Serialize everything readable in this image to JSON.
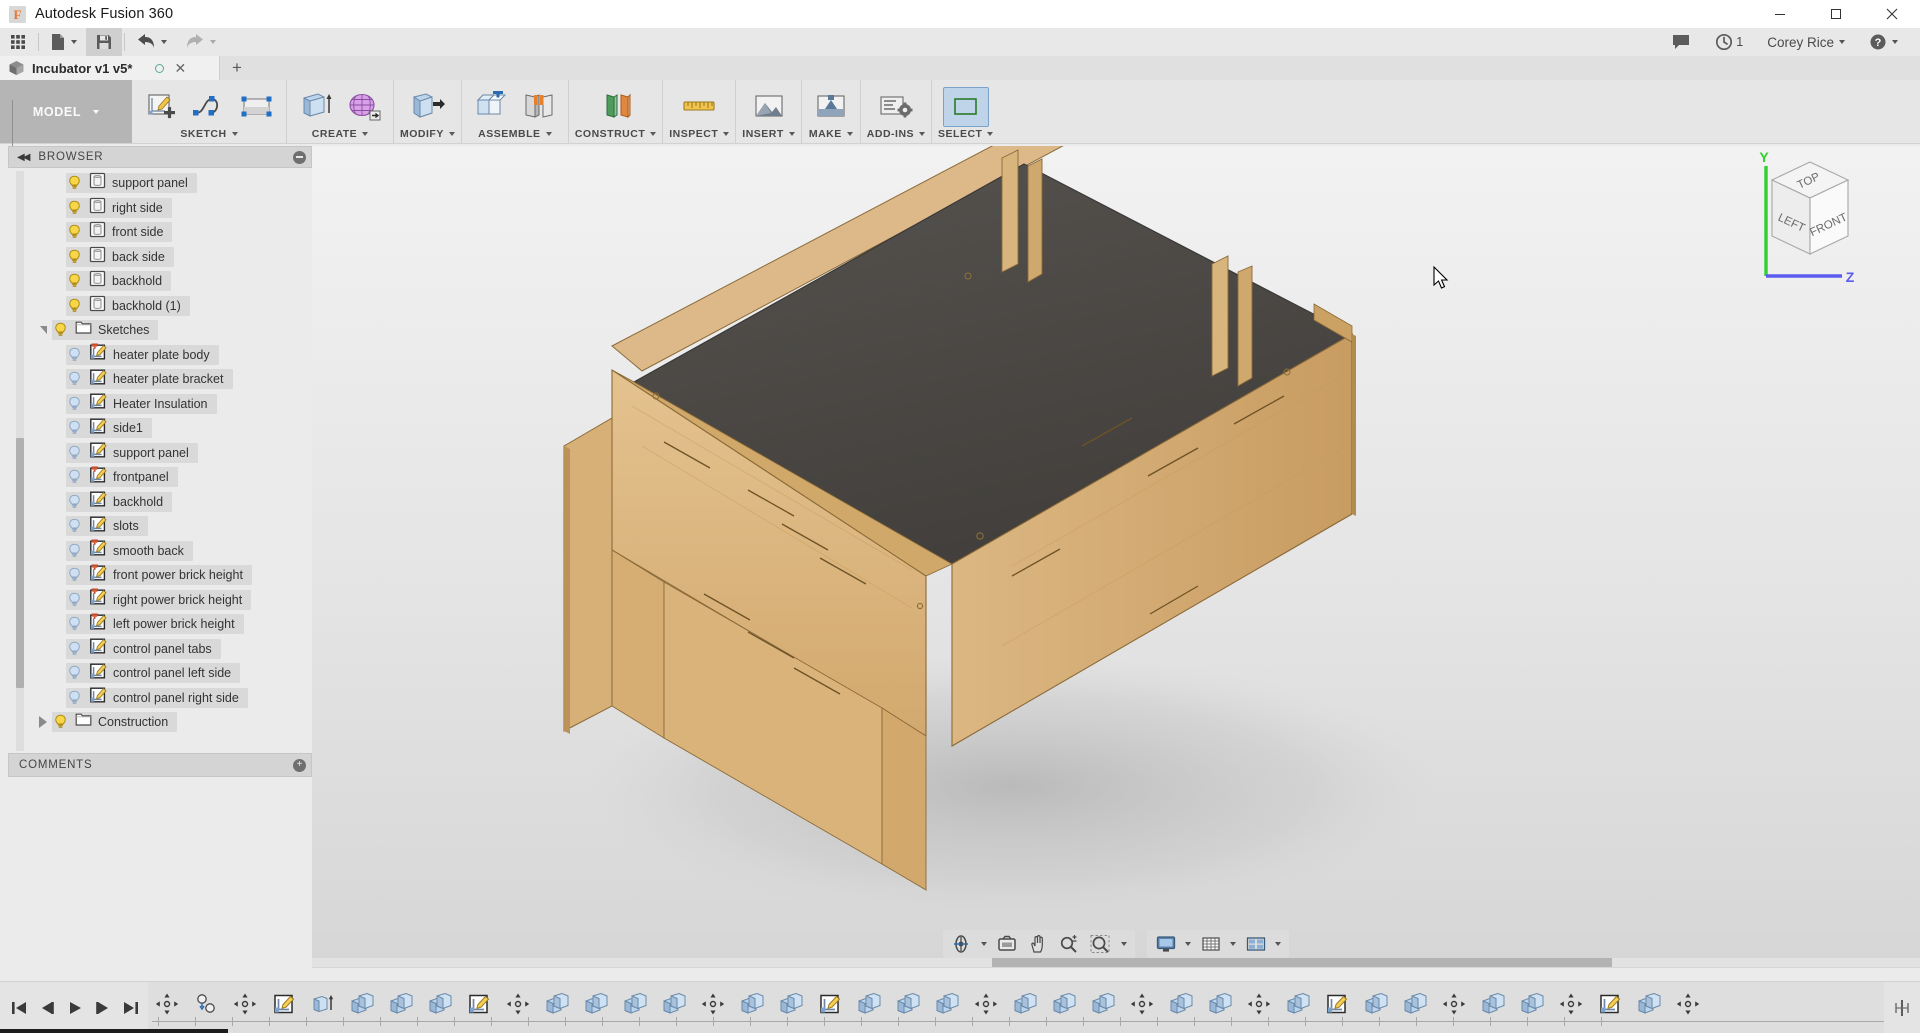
{
  "window": {
    "app_title": "Autodesk Fusion 360",
    "logo_letter": "F",
    "minimize": "minimize-icon",
    "maximize": "maximize-icon",
    "close": "close-icon"
  },
  "quick_access": {
    "grid_menu": "app-grid-icon",
    "new_file": "new-file-icon",
    "save": "save-icon",
    "undo": "undo-icon",
    "redo": "redo-icon",
    "comments_icon": "comment-icon",
    "job_status_icon": "clock-icon",
    "job_status_count": "1",
    "user_name": "Corey Rice",
    "help_icon": "help-icon"
  },
  "document_tabs": {
    "active_tab": "Incubator v1 v5*",
    "new_tab_label": "+"
  },
  "ribbon": {
    "workspace_label": "MODEL",
    "groups": [
      {
        "label": "SKETCH",
        "tools": [
          "create-sketch-icon",
          "spline-icon",
          "rectangle-icon"
        ]
      },
      {
        "label": "CREATE",
        "tools": [
          "extrude-icon",
          "form-icon"
        ]
      },
      {
        "label": "MODIFY",
        "tools": [
          "press-pull-icon"
        ]
      },
      {
        "label": "ASSEMBLE",
        "tools": [
          "new-component-icon",
          "joint-icon"
        ]
      },
      {
        "label": "CONSTRUCT",
        "tools": [
          "offset-plane-icon"
        ]
      },
      {
        "label": "INSPECT",
        "tools": [
          "measure-icon"
        ]
      },
      {
        "label": "INSERT",
        "tools": [
          "insert-mesh-icon"
        ]
      },
      {
        "label": "MAKE",
        "tools": [
          "3d-print-icon"
        ]
      },
      {
        "label": "ADD-INS",
        "tools": [
          "scripts-addins-icon"
        ]
      },
      {
        "label": "SELECT",
        "tools": [
          "select-icon"
        ]
      }
    ]
  },
  "browser": {
    "panel_title": "BROWSER",
    "collapse_icon": "collapse-left-icon",
    "pin_icon": "minimize-panel-icon",
    "items": [
      {
        "label": "support panel",
        "type": "body",
        "visible": true,
        "indent": 3,
        "arrow": "none",
        "pin": false
      },
      {
        "label": "right side",
        "type": "body",
        "visible": true,
        "indent": 3,
        "arrow": "none",
        "pin": false
      },
      {
        "label": "front side",
        "type": "body",
        "visible": true,
        "indent": 3,
        "arrow": "none",
        "pin": false
      },
      {
        "label": "back side",
        "type": "body",
        "visible": true,
        "indent": 3,
        "arrow": "none",
        "pin": false
      },
      {
        "label": "backhold",
        "type": "body",
        "visible": true,
        "indent": 3,
        "arrow": "none",
        "pin": false
      },
      {
        "label": "backhold (1)",
        "type": "body",
        "visible": true,
        "indent": 3,
        "arrow": "none",
        "pin": false
      },
      {
        "label": "Sketches",
        "type": "folder",
        "visible": true,
        "indent": 2,
        "arrow": "down",
        "pin": false
      },
      {
        "label": "heater plate body",
        "type": "sketch",
        "visible": false,
        "indent": 3,
        "arrow": "none",
        "pin": true
      },
      {
        "label": "heater plate bracket",
        "type": "sketch",
        "visible": false,
        "indent": 3,
        "arrow": "none",
        "pin": false
      },
      {
        "label": "Heater Insulation",
        "type": "sketch",
        "visible": false,
        "indent": 3,
        "arrow": "none",
        "pin": false
      },
      {
        "label": "side1",
        "type": "sketch",
        "visible": false,
        "indent": 3,
        "arrow": "none",
        "pin": false
      },
      {
        "label": "support panel",
        "type": "sketch",
        "visible": false,
        "indent": 3,
        "arrow": "none",
        "pin": false
      },
      {
        "label": "frontpanel",
        "type": "sketch",
        "visible": false,
        "indent": 3,
        "arrow": "none",
        "pin": true
      },
      {
        "label": "backhold",
        "type": "sketch",
        "visible": false,
        "indent": 3,
        "arrow": "none",
        "pin": false
      },
      {
        "label": "slots",
        "type": "sketch",
        "visible": false,
        "indent": 3,
        "arrow": "none",
        "pin": false
      },
      {
        "label": "smooth back",
        "type": "sketch",
        "visible": false,
        "indent": 3,
        "arrow": "none",
        "pin": true
      },
      {
        "label": "front power brick height",
        "type": "sketch",
        "visible": false,
        "indent": 3,
        "arrow": "none",
        "pin": true
      },
      {
        "label": "right power brick height",
        "type": "sketch",
        "visible": false,
        "indent": 3,
        "arrow": "none",
        "pin": true
      },
      {
        "label": "left power brick height",
        "type": "sketch",
        "visible": false,
        "indent": 3,
        "arrow": "none",
        "pin": true
      },
      {
        "label": "control panel tabs",
        "type": "sketch",
        "visible": false,
        "indent": 3,
        "arrow": "none",
        "pin": false
      },
      {
        "label": "control panel left side",
        "type": "sketch",
        "visible": false,
        "indent": 3,
        "arrow": "none",
        "pin": false
      },
      {
        "label": "control panel right side",
        "type": "sketch",
        "visible": false,
        "indent": 3,
        "arrow": "none",
        "pin": false
      },
      {
        "label": "Construction",
        "type": "folder",
        "visible": true,
        "indent": 2,
        "arrow": "right",
        "pin": false
      }
    ]
  },
  "comments_panel": {
    "title": "COMMENTS",
    "pin_icon": "expand-panel-icon"
  },
  "view_cube": {
    "top_face": "TOP",
    "left_face": "LEFT",
    "front_face": "FRONT",
    "axis_y": "Y",
    "axis_z": "Z",
    "y_color": "#2fd02f",
    "z_color": "#5b5bf0"
  },
  "nav_bar": {
    "group1": [
      "orbit-icon",
      "look-at-icon",
      "pan-icon",
      "zoom-icon",
      "fit-icon"
    ],
    "group2": [
      "display-settings-icon",
      "grid-snaps-icon",
      "viewports-icon"
    ]
  },
  "timeline": {
    "playback": [
      "jump-to-beginning-icon",
      "step-back-icon",
      "play-icon",
      "step-forward-icon",
      "jump-to-end-icon"
    ],
    "features": [
      "move-icon",
      "joint-icon",
      "move-icon",
      "sketch-icon",
      "extrude-icon",
      "copy-paste-icon",
      "copy-paste-icon",
      "copy-paste-icon",
      "sketch-icon",
      "move-icon",
      "copy-paste-icon",
      "copy-paste-icon",
      "copy-paste-icon",
      "copy-paste-icon",
      "move-icon",
      "copy-paste-icon",
      "copy-paste-icon",
      "sketch-icon",
      "copy-paste-icon",
      "copy-paste-icon",
      "copy-paste-icon",
      "move-icon",
      "copy-paste-icon",
      "copy-paste-icon",
      "copy-paste-icon",
      "move-icon",
      "copy-paste-icon",
      "copy-paste-icon",
      "move-icon",
      "copy-paste-icon",
      "sketch-icon",
      "copy-paste-icon",
      "copy-paste-icon",
      "move-icon",
      "copy-paste-icon",
      "copy-paste-icon",
      "move-icon",
      "sketch-icon",
      "copy-paste-icon",
      "move-icon"
    ],
    "end_marker": "timeline-end-icon"
  },
  "model": {
    "description": "Laser-cut plywood incubator box assembly, isometric view",
    "wood_light": "#e2bf8a",
    "wood_mid": "#d4ab70",
    "wood_dark": "#b88c52",
    "plate_color": "#4a4847"
  }
}
